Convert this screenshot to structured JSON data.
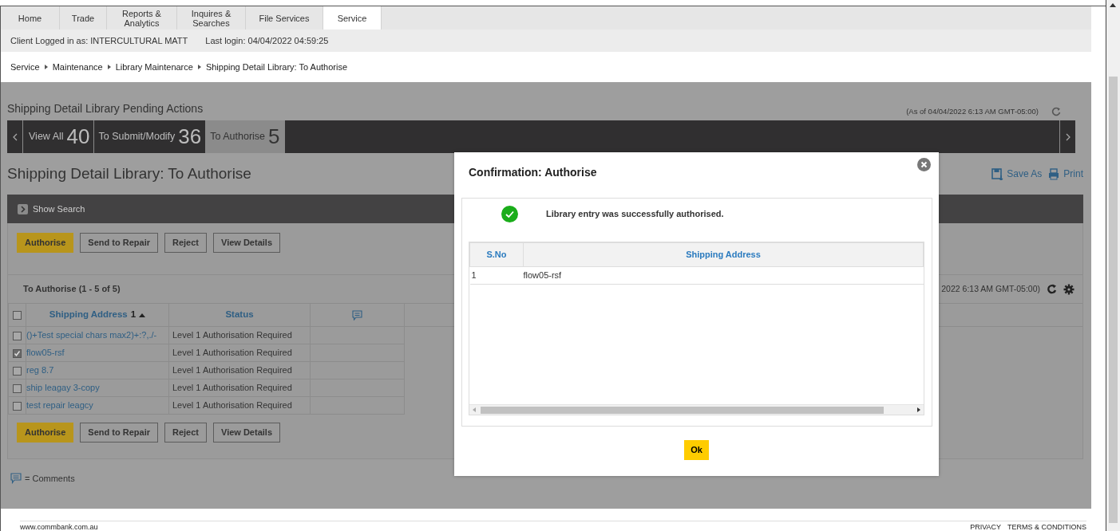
{
  "nav_tabs": [
    {
      "label": "Home",
      "selected": false
    },
    {
      "label": "Trade",
      "selected": false
    },
    {
      "label": "Reports & Analytics",
      "selected": false
    },
    {
      "label": "Inquires & Searches",
      "selected": false
    },
    {
      "label": "File Services",
      "selected": false
    },
    {
      "label": "Service",
      "selected": true
    }
  ],
  "session": {
    "client": "Client Logged in as: INTERCULTURAL MATT",
    "last_login": "Last login: 04/04/2022 04:59:25"
  },
  "breadcrumb": [
    "Service",
    "Maintenance",
    "Library Maintenarce",
    "Shipping Detail Library: To Authorise"
  ],
  "pending": {
    "title": "Shipping Detail Library Pending Actions",
    "as_of": "(As of 04/04/2022 6:13 AM GMT-05:00)",
    "tabs": [
      {
        "label": "View All",
        "count": "40",
        "selected": false
      },
      {
        "label": "To Submit/Modify",
        "count": "36",
        "selected": false
      },
      {
        "label": "To Authorise",
        "count": "5",
        "selected": true
      }
    ]
  },
  "page_title": "Shipping Detail Library: To Authorise",
  "tools": [
    "Save As",
    "Print"
  ],
  "show_search": "Show Search",
  "top_actions": [
    {
      "label": "Authorise",
      "kind": "primary"
    },
    {
      "label": "Send to Repair",
      "kind": "secondary"
    },
    {
      "label": "Reject",
      "kind": "secondary"
    },
    {
      "label": "View Details",
      "kind": "secondary"
    }
  ],
  "results": {
    "caption": "To Authorise (1 - 5 of 5)",
    "as_of": "2022 6:13 AM GMT-05:00)",
    "header_checked": false,
    "columns": [
      {
        "label": "Shipping Address",
        "sort": "1"
      },
      {
        "label": "Status"
      }
    ],
    "rows": [
      {
        "address": "()+Test special chars max2)+:?,./-",
        "status": "Level 1 Authorisation Required",
        "checked": false
      },
      {
        "address": "flow05-rsf",
        "status": "Level 1 Authorisation Required",
        "checked": true
      },
      {
        "address": "reg 8.7",
        "status": "Level 1 Authorisation Required",
        "checked": false
      },
      {
        "address": "ship leagay 3-copy",
        "status": "Level 1 Authorisation Required",
        "checked": false
      },
      {
        "address": "test repair leagcy",
        "status": "Level 1 Authorisation Required",
        "checked": false
      }
    ]
  },
  "bottom_actions": [
    {
      "label": "Authorise",
      "kind": "primary"
    },
    {
      "label": "Send to Repair",
      "kind": "secondary"
    },
    {
      "label": "Reject",
      "kind": "secondary"
    },
    {
      "label": "View Details",
      "kind": "secondary"
    }
  ],
  "legend": "= Comments",
  "dialog": {
    "title": "Confirmation: Authorise",
    "message": "Library entry was successfully authorised.",
    "columns": [
      "S.No",
      "Shipping Address"
    ],
    "rows": [
      {
        "sno": "1",
        "address": "flow05-rsf"
      }
    ],
    "ok": "Ok"
  },
  "footer": {
    "site": "www.commbank.com.au",
    "links": [
      "PRIVACY",
      "TERMS & CONDITIONS"
    ]
  }
}
